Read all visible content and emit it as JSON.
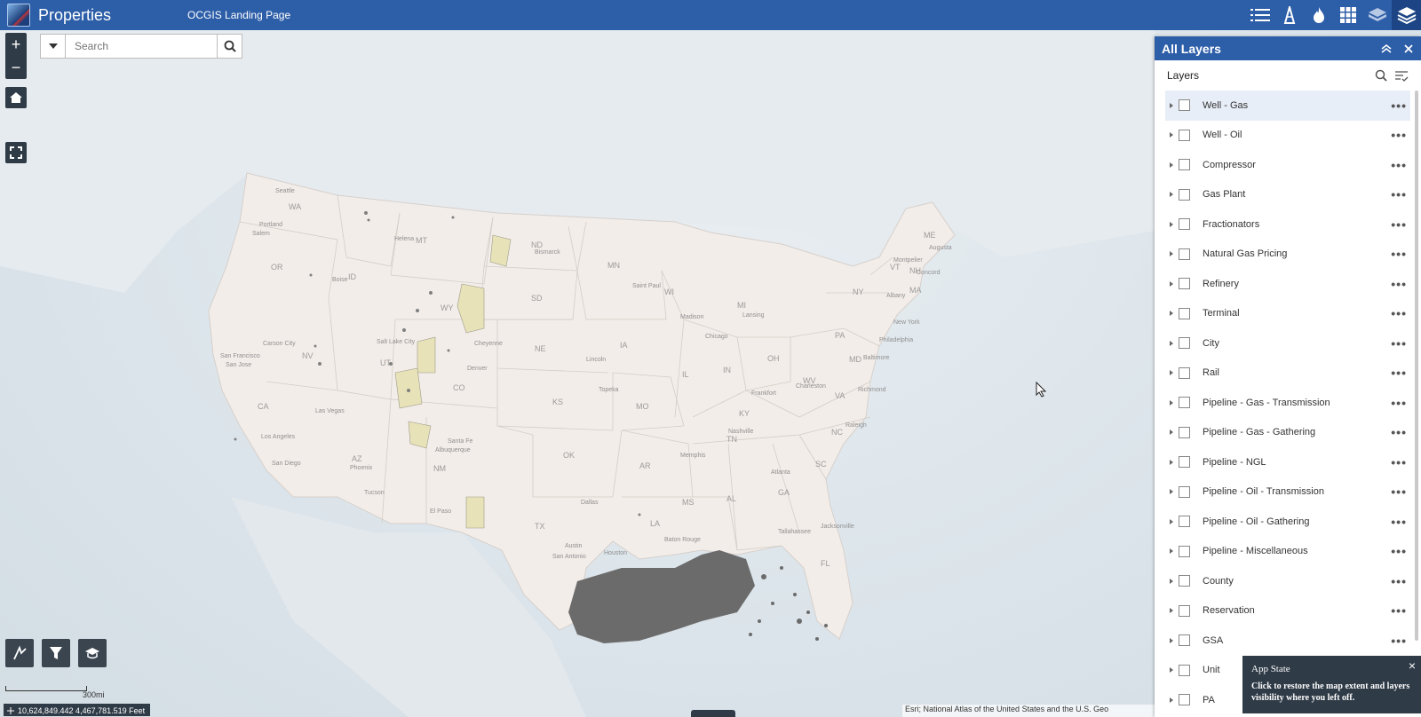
{
  "header": {
    "title": "Properties",
    "link": "OCGIS Landing Page",
    "tools": [
      "list-icon",
      "well-icon",
      "flame-icon",
      "grid-icon",
      "basemap-icon",
      "layers-icon"
    ]
  },
  "search": {
    "placeholder": "Search"
  },
  "map": {
    "state_labels": [
      "WA",
      "OR",
      "ID",
      "MT",
      "ND",
      "SD",
      "NE",
      "KS",
      "OK",
      "TX",
      "NM",
      "AZ",
      "CA",
      "NV",
      "UT",
      "CO",
      "WY",
      "MN",
      "IA",
      "MO",
      "AR",
      "LA",
      "MS",
      "AL",
      "GA",
      "FL",
      "TN",
      "KY",
      "IL",
      "IN",
      "OH",
      "MI",
      "WI",
      "PA",
      "NY",
      "ME",
      "VT",
      "NH",
      "MA",
      "VA",
      "NC",
      "SC",
      "WV",
      "MD"
    ],
    "city_labels": [
      "Seattle",
      "Portland",
      "Salem",
      "Boise",
      "Helena",
      "Bismarck",
      "Saint Paul",
      "Madison",
      "Lansing",
      "Chicago",
      "Salt Lake City",
      "Carson City",
      "San Francisco",
      "San Jose",
      "Las Vegas",
      "Los Angeles",
      "San Diego",
      "Phoenix",
      "Tucson",
      "Cheyenne",
      "Denver",
      "Lincoln",
      "Topeka",
      "Santa Fe",
      "Albuquerque",
      "El Paso",
      "Dallas",
      "Austin",
      "San Antonio",
      "Houston",
      "Baton Rouge",
      "Memphis",
      "Nashville",
      "Frankfort",
      "Atlanta",
      "Tallahassee",
      "Jacksonville",
      "Raleigh",
      "Richmond",
      "Charleston",
      "Baltimore",
      "Philadelphia",
      "New York",
      "Albany",
      "Montpelier",
      "Concord",
      "Augusta",
      "Boston"
    ],
    "scale_label": "300mi",
    "coordinates": "10,624,849.442 4,467,781.519 Feet",
    "attribution": "Esri; National Atlas of the United States and the U.S. Geo"
  },
  "panel": {
    "title": "All Layers",
    "subtitle": "Layers",
    "layers": [
      "Well - Gas",
      "Well - Oil",
      "Compressor",
      "Gas Plant",
      "Fractionators",
      "Natural Gas Pricing",
      "Refinery",
      "Terminal",
      "City",
      "Rail",
      "Pipeline - Gas - Transmission",
      "Pipeline - Gas - Gathering",
      "Pipeline - NGL",
      "Pipeline - Oil - Transmission",
      "Pipeline - Oil - Gathering",
      "Pipeline - Miscellaneous",
      "County",
      "Reservation",
      "GSA",
      "Unit",
      "PA"
    ]
  },
  "toast": {
    "title": "App State",
    "message": "Click to restore the map extent and layers visibility where you left off."
  }
}
